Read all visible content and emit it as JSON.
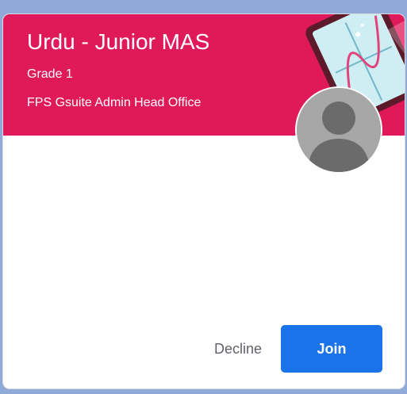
{
  "class_card": {
    "title": "Urdu - Junior MAS",
    "section": "Grade 1",
    "owner": "FPS Gsuite Admin Head Office",
    "banner_color": "#e01a5a",
    "banner_illustration": "math-graph-tablet-illustration",
    "avatar_icon": "default-user-avatar-icon"
  },
  "actions": {
    "decline_label": "Decline",
    "join_label": "Join",
    "join_color": "#1a73e8"
  }
}
